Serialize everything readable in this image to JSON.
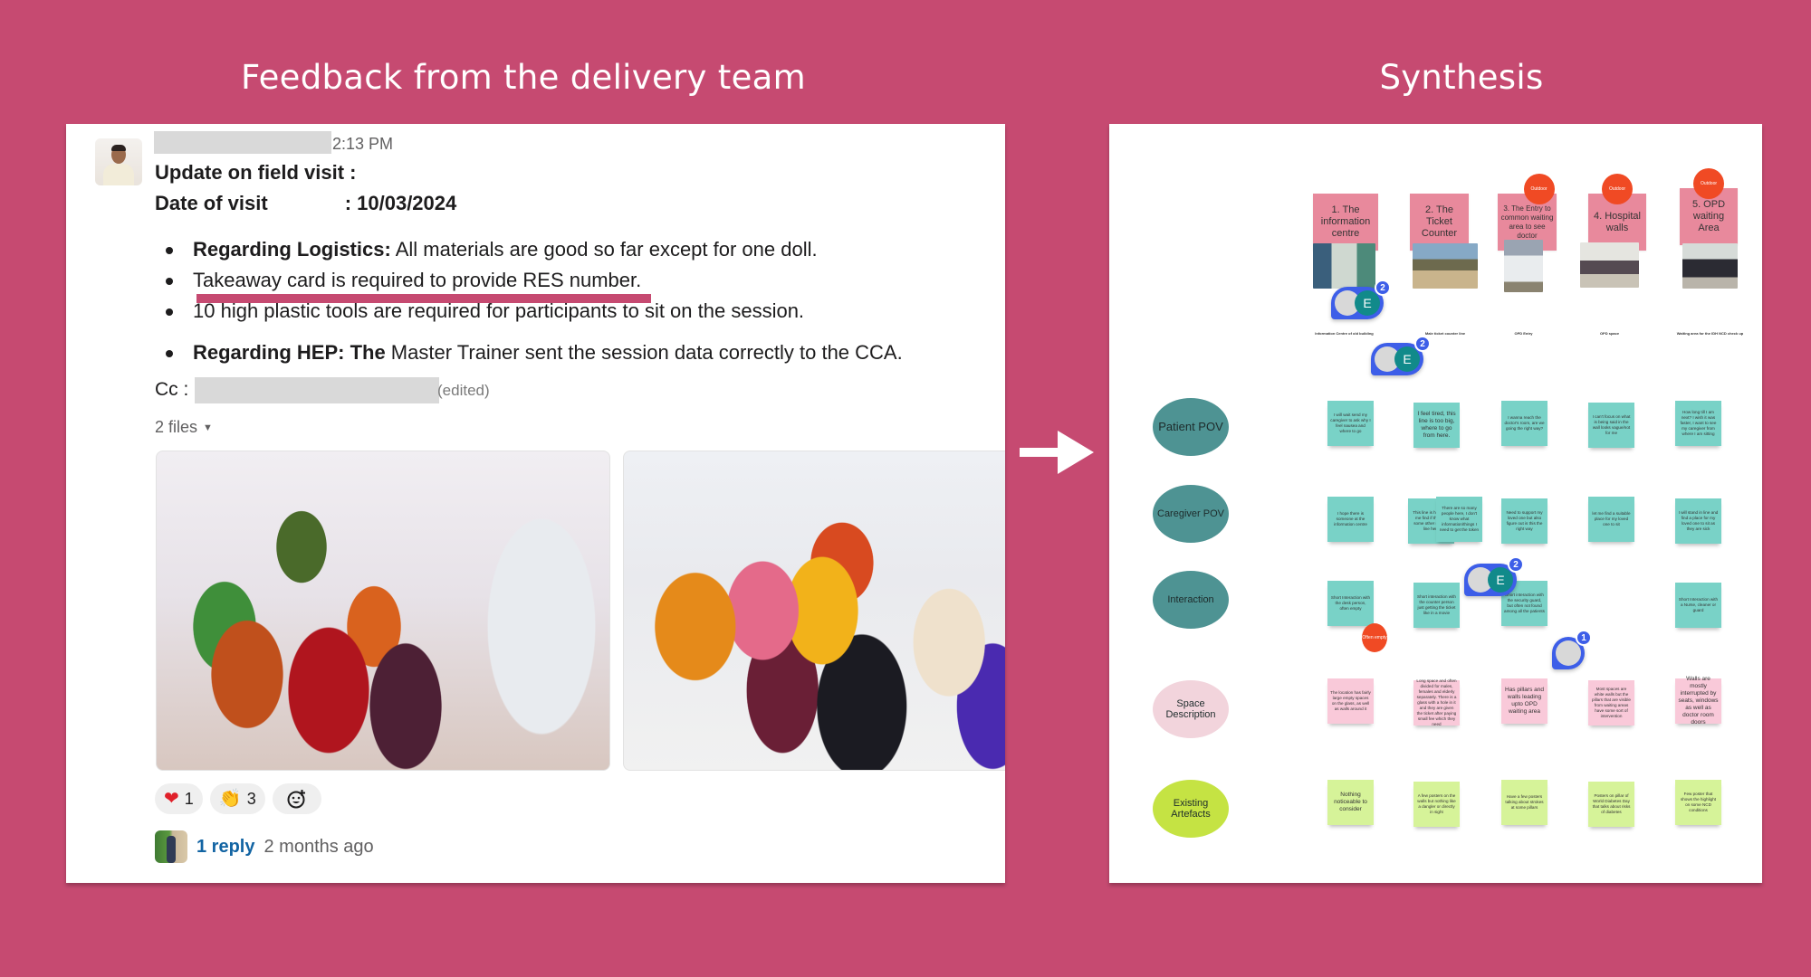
{
  "titles": {
    "left": "Feedback from the delivery team",
    "right": "Synthesis"
  },
  "message": {
    "timestamp": "2:13 PM",
    "line_update": "Update on field visit :",
    "date_label": "Date of visit",
    "date_value": ": 10/03/2024",
    "bullets": [
      {
        "bold": "Regarding Logistics:",
        "text": " All materials are good so far except for one doll."
      },
      {
        "bold": "",
        "text": "Takeaway card is required to provide RES number."
      },
      {
        "bold": "",
        "text": "10 high plastic tools are required for participants to sit on the session."
      },
      {
        "bold": "Regarding  HEP: The",
        "text": " Master Trainer sent the session data  correctly to the CCA."
      }
    ],
    "cc_label": "Cc :",
    "edited": "(edited)",
    "files_label": "2 files",
    "reactions": [
      {
        "emoji": "heart-emoji",
        "glyph": "❤",
        "count": "1"
      },
      {
        "emoji": "clap-emoji",
        "glyph": "👏",
        "count": "3"
      }
    ],
    "reply_link": "1 reply",
    "reply_time": "2 months ago"
  },
  "board": {
    "headers": [
      {
        "label": "1. The information centre",
        "tag": ""
      },
      {
        "label": "2. The Ticket Counter",
        "tag": ""
      },
      {
        "label": "3. The Entry to common waiting area to see doctor",
        "tag": "Outdoor"
      },
      {
        "label": "4. Hospital walls",
        "tag": "Outdoor"
      },
      {
        "label": "5. OPD waiting Area",
        "tag": "Outdoor"
      }
    ],
    "photo_captions": [
      "Information Centre of old building",
      "Male ticket counter line",
      "OPD Entry",
      "OPD space",
      "Waiting area for the IDH NCD check up"
    ],
    "rows": [
      {
        "label": "Patient POV",
        "stickies": [
          "I will wait send my caregiver to ask why I feel nausea and where to go",
          "I feel tired, this line is too big, where to go from here.",
          "I wanna reach the doctor's room, are we going the right way?",
          "I can't focus on what is being said in the wall looks vague/not for me",
          "How long till I am next? I wish it was faster, I want to see my caregiver from where I am sitting"
        ]
      },
      {
        "label": "Caregiver POV",
        "stickies": [
          "I hope there is someone at the information centre",
          "This line is huge, let me find if there is some other special line here",
          "There are so many people here, I don't know what information/things I need to get the token",
          "Need to support my loved one but also figure out is this the right way",
          "let me find a suitable place for my loved one to sit",
          "I will stand in line and find a place for my loved one to sit as they are sick"
        ]
      },
      {
        "label": "Interaction",
        "stickies": [
          "Short Interaction with the desk person, often empty",
          "Short interaction with the counter person just getting the ticket like in a movie",
          "Short interaction with the security guard, but often not found among all the patients",
          "Short Interaction with a Nurse, cleaner or guard"
        ],
        "tag": "Often empty"
      },
      {
        "label": "Space Description",
        "stickies": [
          "The location has fairly large empty spaces on the glass, as well as walls around it",
          "Long space and often divided for males, females and elderly separately. There is a glass with a hole in it and they are given the ticket after paying small fee which they need",
          "Has pillars and walls leading upto OPD waiting area",
          "Most spaces are white walls but the pillars that are visible from waiting areas have some sort of intervention",
          "Walls are mostly interrupted by seats, windows as well as doctor room doors"
        ]
      },
      {
        "label": "Existing Artefacts",
        "stickies": [
          "Nothing noticeable to consider",
          "A few posters on the walls but nothing like a dangler or directly in sight",
          "Have a few posters talking about strokes at some pillars",
          "Posters on pillar of World Diabetes Day that talks about risks of diabetes",
          "Few poster that shows the highlight on some NCD conditions"
        ]
      }
    ],
    "comments": [
      {
        "initial": "E",
        "count": "2"
      },
      {
        "initial": "E",
        "count": "2"
      },
      {
        "initial": "E",
        "count": "2"
      },
      {
        "initial": "",
        "count": "1"
      }
    ]
  },
  "colors": {
    "background": "#c64a71",
    "link": "#1264a3",
    "header_sticky": "#e8899c",
    "outdoor_tag": "#f04a24",
    "teal_label": "#4e9393",
    "teal_sticky": "#79d2c7",
    "pink_sticky": "#f9c9d9",
    "lime_sticky": "#d6f399",
    "comment_blue": "#3d5ee8"
  }
}
